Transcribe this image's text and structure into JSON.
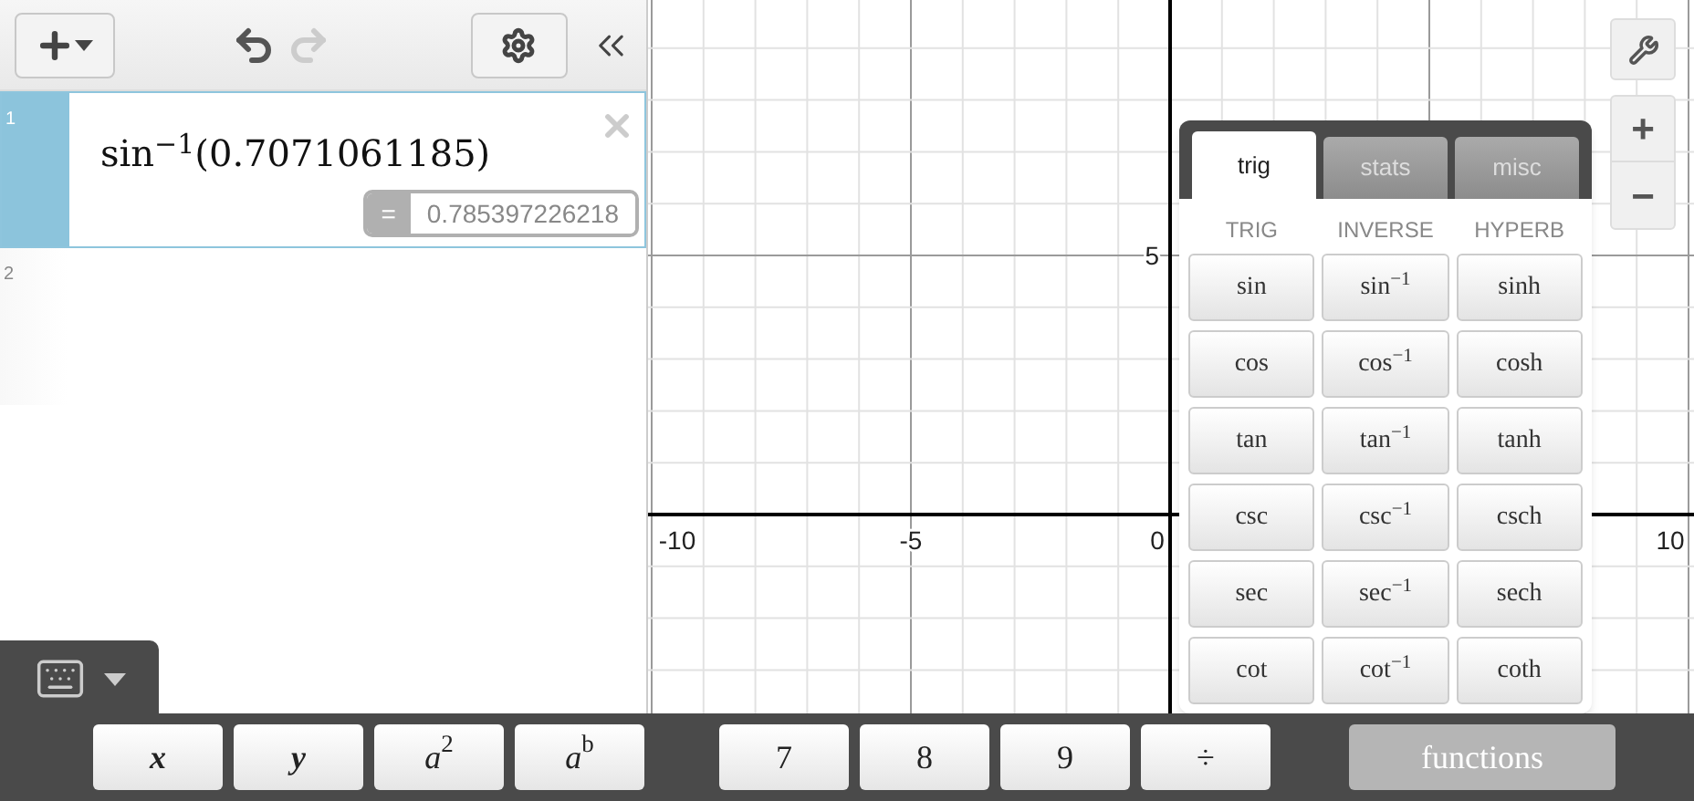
{
  "toolbar": {
    "undo_enabled": true,
    "redo_enabled": false
  },
  "expressions": [
    {
      "number": "1",
      "selected": true,
      "formula": "sin$^{−1}$(0.7071061185)",
      "equals": "=",
      "result": "0.785397226218"
    },
    {
      "number": "2",
      "selected": false
    }
  ],
  "graph": {
    "x_labels": [
      "-10",
      "-5",
      "0",
      "10"
    ],
    "y_labels": [
      "5"
    ]
  },
  "keyboard_toggle": {
    "selected": true
  },
  "zoom": {
    "zoom_in": "+",
    "zoom_out": "−"
  },
  "functions_popup": {
    "tabs": [
      {
        "label": "trig",
        "selected": true
      },
      {
        "label": "stats",
        "selected": false
      },
      {
        "label": "misc",
        "selected": false
      }
    ],
    "columns": [
      "TRIG",
      "INVERSE",
      "HYPERB"
    ],
    "rows": [
      [
        "sin",
        "sin$^{−1}$",
        "sinh"
      ],
      [
        "cos",
        "cos$^{−1}$",
        "cosh"
      ],
      [
        "tan",
        "tan$^{−1}$",
        "tanh"
      ],
      [
        "csc",
        "csc$^{−1}$",
        "csch"
      ],
      [
        "sec",
        "sec$^{−1}$",
        "sech"
      ],
      [
        "cot",
        "cot$^{−1}$",
        "coth"
      ]
    ]
  },
  "keypad": {
    "groups": [
      [
        {
          "label": "x",
          "kind": "var"
        },
        {
          "label": "y",
          "kind": "var"
        },
        {
          "label": "*a*$^{2}$",
          "kind": "math"
        },
        {
          "label": "*a*$^{b}$",
          "kind": "math"
        }
      ],
      [
        {
          "label": "7",
          "kind": "math"
        },
        {
          "label": "8",
          "kind": "math"
        },
        {
          "label": "9",
          "kind": "math"
        },
        {
          "label": "÷",
          "kind": "math"
        }
      ],
      [
        {
          "label": "functions",
          "kind": "toggle",
          "selected": true
        }
      ]
    ]
  }
}
